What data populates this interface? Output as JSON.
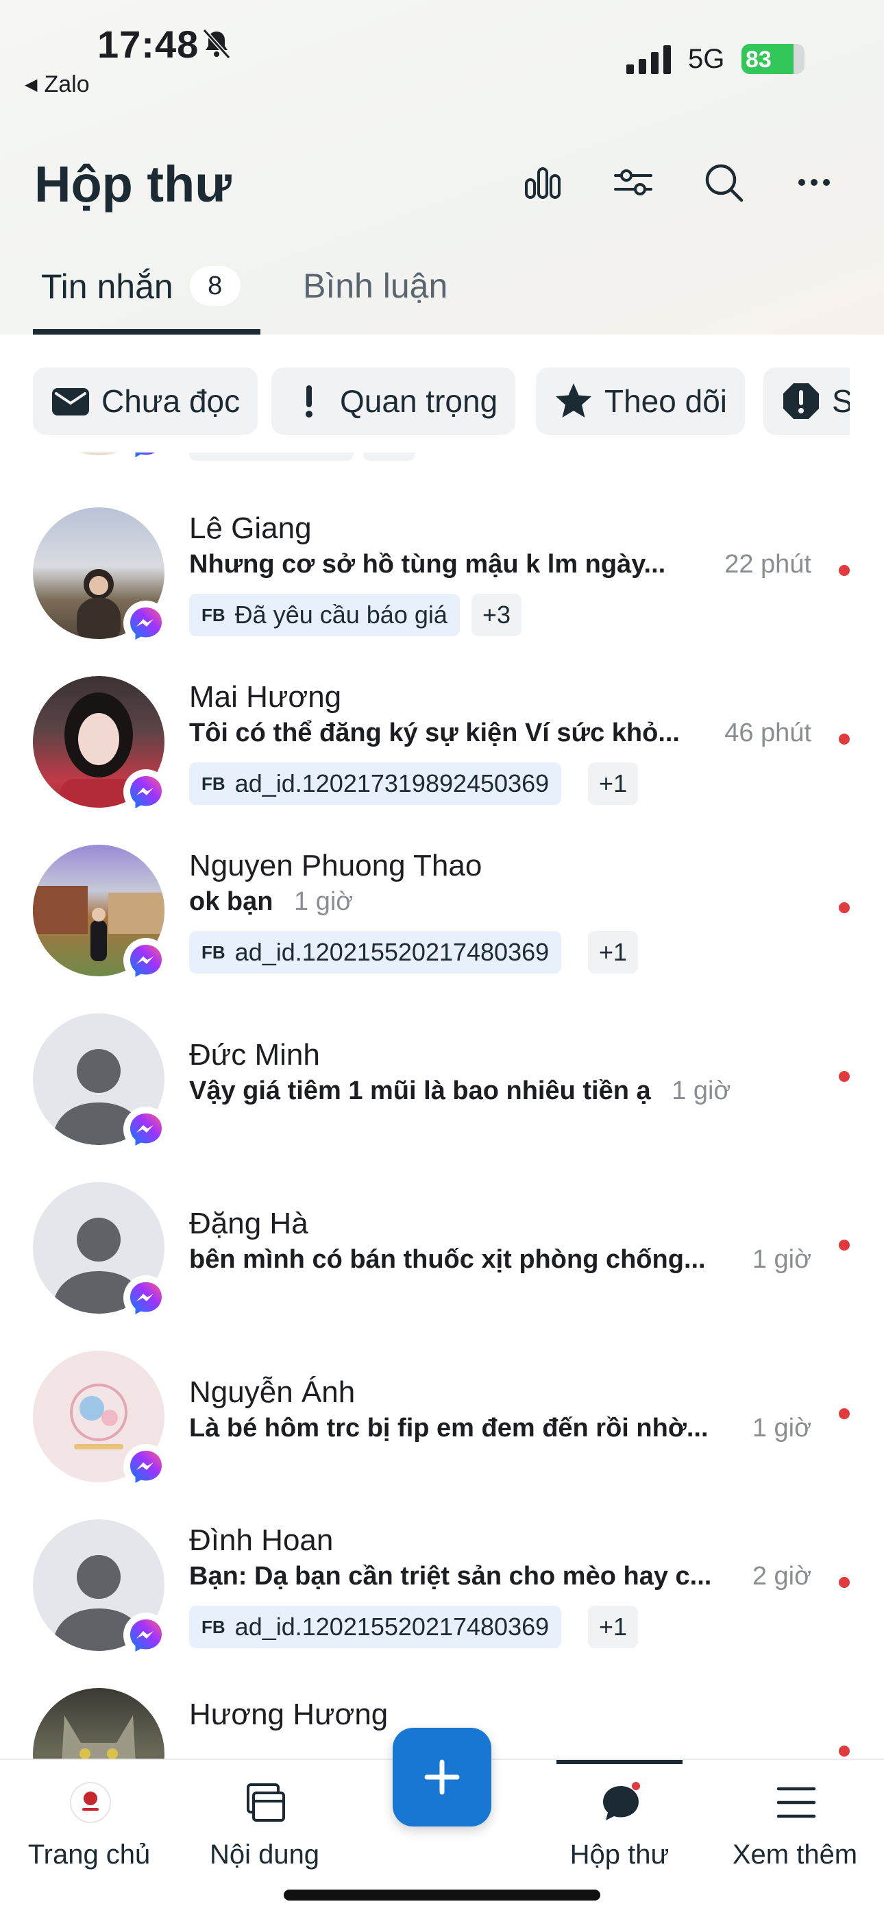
{
  "status_bar": {
    "time": "17:48",
    "back_app": "Zalo",
    "network": "5G",
    "battery_level": "83",
    "battery_fraction": 0.83
  },
  "header": {
    "title": "Hộp thư",
    "icons": [
      "bar-chart-icon",
      "filter-sliders-icon",
      "search-icon",
      "more-icon"
    ]
  },
  "tabs": [
    {
      "label": "Tin nhắn",
      "badge": "8",
      "active": true
    },
    {
      "label": "Bình luận",
      "active": false
    }
  ],
  "filters": [
    {
      "label": "Chưa đọc",
      "icon": "envelope-icon"
    },
    {
      "label": "Quan trọng",
      "icon": "exclamation-icon"
    },
    {
      "label": "Theo dõi",
      "icon": "star-icon"
    },
    {
      "label": "S",
      "icon": "alert-octagon-icon"
    }
  ],
  "conversations": [
    {
      "name": "Lê Giang",
      "preview": "Nhưng cơ sở hồ tùng mậu k lm ngày...",
      "time": "22 phút",
      "tag": "Đã yêu cầu báo giá",
      "tag_more": "+3"
    },
    {
      "name": "Mai Hương",
      "preview": "Tôi có thể đăng ký sự kiện Ví sức khỏ...",
      "time": "46 phút",
      "tag": "ad_id.120217319892450369",
      "tag_more": "+1"
    },
    {
      "name": "Nguyen Phuong Thao",
      "preview": "ok bạn",
      "time": "1 giờ",
      "tag": "ad_id.120215520217480369",
      "tag_more": "+1"
    },
    {
      "name": "Đức Minh",
      "preview": "Vậy giá tiêm 1 mũi là bao nhiêu tiền ạ",
      "time": "1 giờ"
    },
    {
      "name": "Đặng Hà",
      "preview": "bên mình có bán thuốc xịt phòng chống...",
      "time": "1 giờ"
    },
    {
      "name": "Nguyễn Ánh",
      "preview": "Là bé hôm trc bị fip em đem đến rồi nhờ...",
      "time": "1 giờ"
    },
    {
      "name": "Đình Hoan",
      "preview": "Bạn: Dạ bạn cần triệt sản cho mèo hay c...",
      "time": "2 giờ",
      "tag": "ad_id.120215520217480369",
      "tag_more": "+1"
    },
    {
      "name": "Hương Hương"
    }
  ],
  "tag_prefix": "FB",
  "bottom_nav": [
    {
      "label": "Trang chủ",
      "icon": "brand-logo-icon"
    },
    {
      "label": "Nội dung",
      "icon": "content-icon"
    },
    {
      "label": "Hộp thư",
      "icon": "chat-bubble-icon",
      "active": true
    },
    {
      "label": "Xem thêm",
      "icon": "menu-icon"
    }
  ],
  "colors": {
    "accent": "#1877d2",
    "unread_dot": "#e0393e",
    "battery_green": "#33c759",
    "tag_bg": "#e7f0fb"
  }
}
